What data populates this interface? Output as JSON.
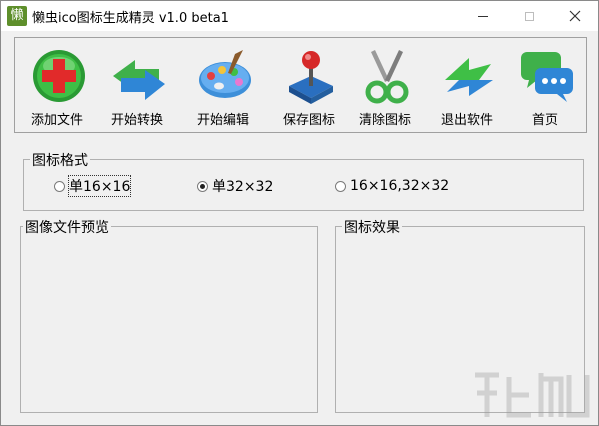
{
  "window": {
    "title": "懒虫ico图标生成精灵 v1.0 beta1",
    "icon_glyph": "懒"
  },
  "toolbar": {
    "items": [
      {
        "label": "添加文件",
        "icon": "add-file-icon"
      },
      {
        "label": "开始转换",
        "icon": "convert-arrows-icon"
      },
      {
        "label": "开始编辑",
        "icon": "paint-palette-icon"
      },
      {
        "label": "保存图标",
        "icon": "joystick-icon"
      },
      {
        "label": "清除图标",
        "icon": "scissors-icon"
      },
      {
        "label": "退出软件",
        "icon": "exit-arrow-icon"
      },
      {
        "label": "首页",
        "icon": "chat-bubble-icon"
      }
    ]
  },
  "format": {
    "title": "图标格式",
    "options": [
      {
        "label": "单16×16",
        "checked": false
      },
      {
        "label": "单32×32",
        "checked": true
      },
      {
        "label": "16×16,32×32",
        "checked": false
      }
    ]
  },
  "preview": {
    "title": "图像文件预览"
  },
  "effect": {
    "title": "图标效果"
  },
  "colors": {
    "window_bg": "#f0f0f0",
    "titlebar_bg": "#ffffff",
    "border": "#a0a0a0"
  }
}
